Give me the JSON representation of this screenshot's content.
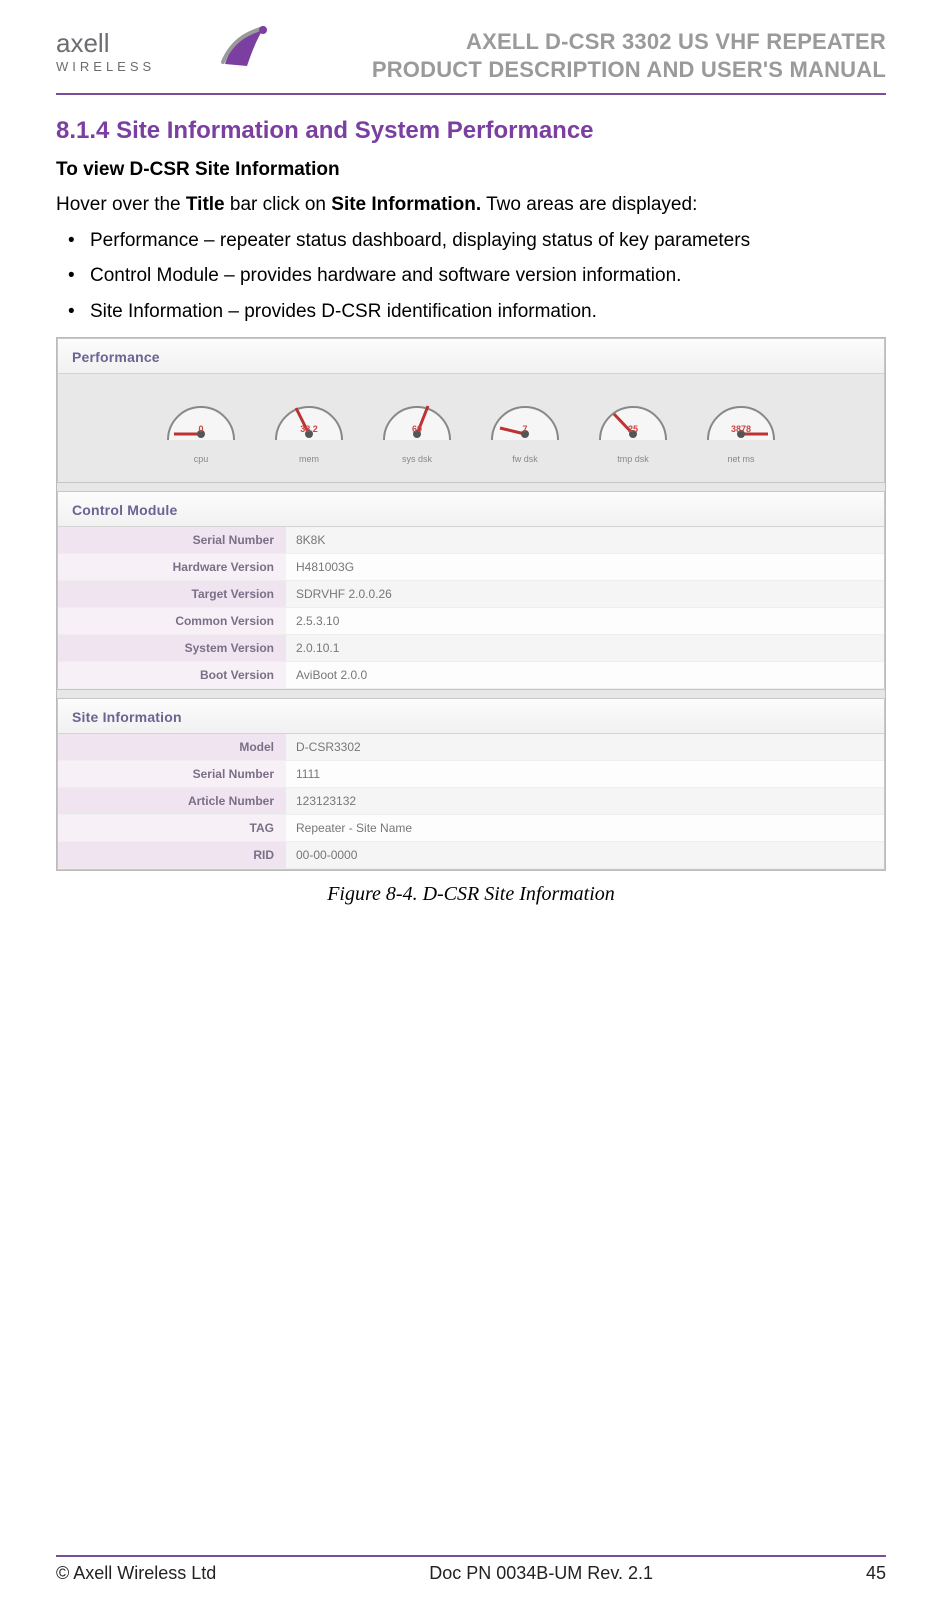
{
  "header": {
    "brand_top": "axell",
    "brand_bottom": "WIRELESS",
    "title_line1": "AXELL D-CSR 3302 US VHF REPEATER",
    "title_line2": "PRODUCT DESCRIPTION AND USER'S MANUAL"
  },
  "section": {
    "number": "8.1.4",
    "title": "Site Information and System Performance"
  },
  "subheading": "To view D-CSR Site Information",
  "intro_prefix": "Hover over the ",
  "intro_bold1": "Title",
  "intro_mid": " bar click on ",
  "intro_bold2": "Site Information.",
  "intro_suffix": " Two areas are displayed:",
  "bullets": [
    "Performance – repeater status dashboard, displaying status of key parameters",
    "Control Module – provides hardware and software version information.",
    "Site Information – provides D-CSR identification information."
  ],
  "panels": {
    "performance": {
      "title": "Performance",
      "gauges": [
        {
          "value": "0",
          "label": "cpu"
        },
        {
          "value": "38.2",
          "label": "mem"
        },
        {
          "value": "60",
          "label": "sys dsk"
        },
        {
          "value": "7",
          "label": "fw dsk"
        },
        {
          "value": "25",
          "label": "tmp dsk"
        },
        {
          "value": "3878",
          "label": "net ms"
        }
      ]
    },
    "control_module": {
      "title": "Control Module",
      "rows": [
        {
          "label": "Serial Number",
          "value": "8K8K"
        },
        {
          "label": "Hardware Version",
          "value": "H481003G"
        },
        {
          "label": "Target Version",
          "value": "SDRVHF 2.0.0.26"
        },
        {
          "label": "Common Version",
          "value": "2.5.3.10"
        },
        {
          "label": "System Version",
          "value": "2.0.10.1"
        },
        {
          "label": "Boot Version",
          "value": "AviBoot 2.0.0"
        }
      ]
    },
    "site_information": {
      "title": "Site Information",
      "rows": [
        {
          "label": "Model",
          "value": "D-CSR3302"
        },
        {
          "label": "Serial Number",
          "value": "1111"
        },
        {
          "label": "Article Number",
          "value": "123123132"
        },
        {
          "label": "TAG",
          "value": "Repeater - Site Name"
        },
        {
          "label": "RID",
          "value": "00-00-0000"
        }
      ]
    }
  },
  "figure_caption": "Figure 8-4. D-CSR Site Information",
  "footer": {
    "left": "© Axell Wireless Ltd",
    "center": "Doc PN 0034B-UM Rev. 2.1",
    "right": "45"
  }
}
